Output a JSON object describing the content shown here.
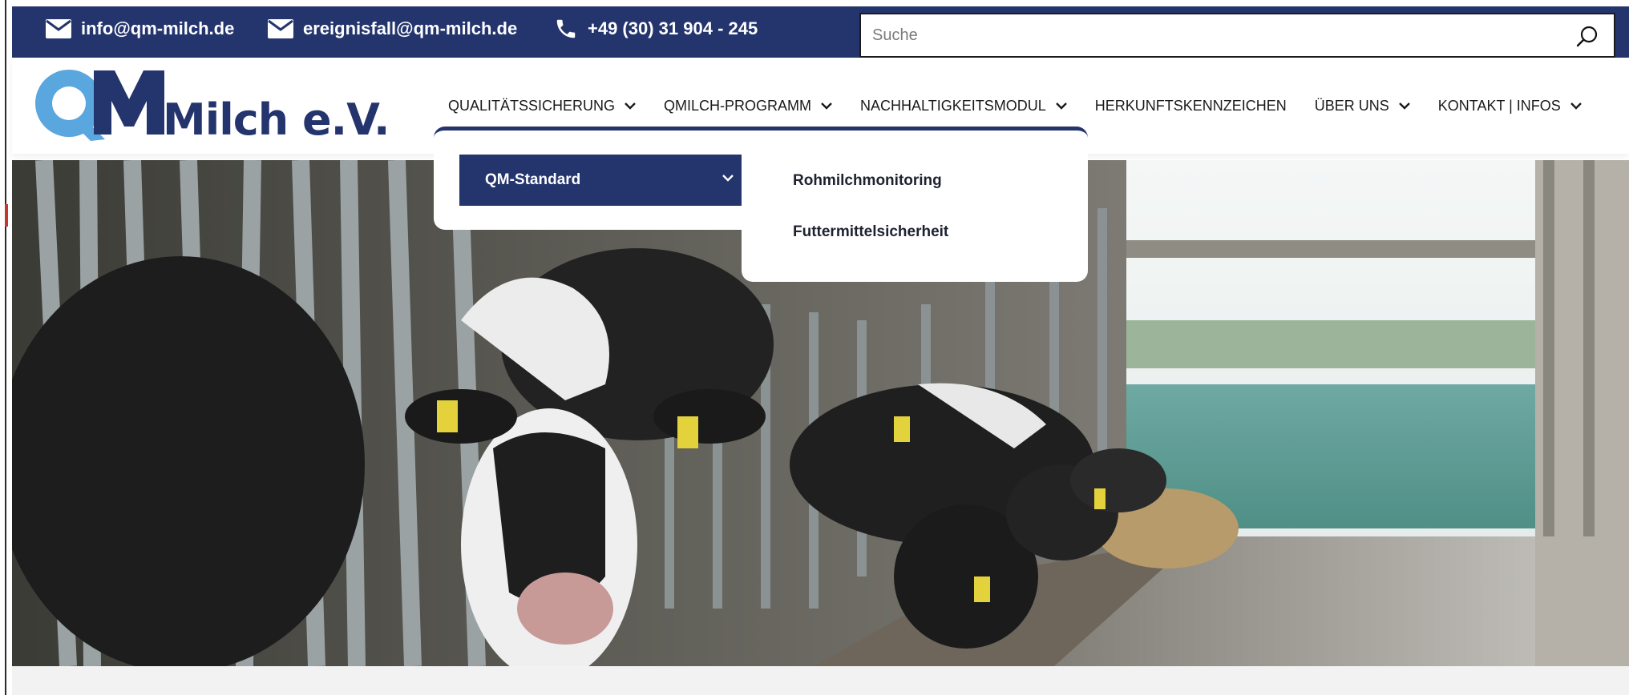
{
  "topbar": {
    "email1": "info@qm-milch.de",
    "email2": "ereignisfall@qm-milch.de",
    "phone": "+49 (30) 31 904 - 245",
    "search_placeholder": "Suche"
  },
  "logo": {
    "text_qm": "QM",
    "text_milch": "Milch e.V."
  },
  "nav": {
    "items": [
      {
        "label": "QUALITÄTSSICHERUNG"
      },
      {
        "label": "QMILCH-PROGRAMM"
      },
      {
        "label": "NACHHALTIGKEITSMODUL"
      },
      {
        "label": "HERKUNFTSKENNZEICHEN"
      },
      {
        "label": "ÜBER UNS"
      },
      {
        "label": "KONTAKT | INFOS"
      }
    ]
  },
  "dropdown": {
    "active_item": "QM-Standard",
    "submenu": [
      "Rohmilchmonitoring",
      "Futtermittelsicherheit"
    ]
  },
  "colors": {
    "brand_navy": "#24346d",
    "logo_light_blue": "#5aa6de"
  }
}
